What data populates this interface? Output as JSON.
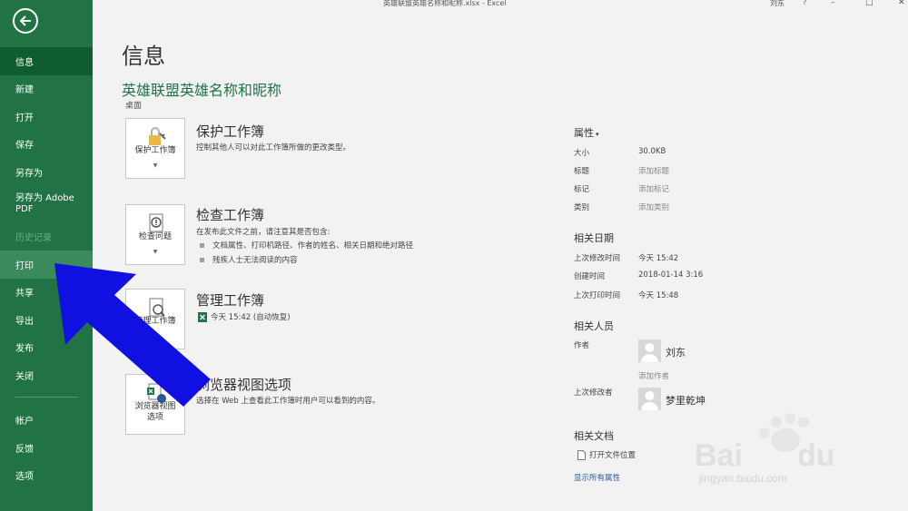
{
  "window": {
    "title": "英雄联盟英雄名称和昵称.xlsx  -  Excel",
    "user": "刘东",
    "help": "?",
    "minimize": "–",
    "restore": "□",
    "close": "✕"
  },
  "sidebar": {
    "items": [
      {
        "label": "信息",
        "state": "active"
      },
      {
        "label": "新建"
      },
      {
        "label": "打开"
      },
      {
        "label": "保存"
      },
      {
        "label": "另存为"
      },
      {
        "label": "另存为 Adobe PDF"
      },
      {
        "label": "历史记录",
        "state": "disabled"
      },
      {
        "label": "打印",
        "state": "hover"
      },
      {
        "label": "共享"
      },
      {
        "label": "导出"
      },
      {
        "label": "发布"
      },
      {
        "label": "关闭"
      }
    ],
    "bottom": [
      {
        "label": "帐户"
      },
      {
        "label": "反馈"
      },
      {
        "label": "选项"
      }
    ]
  },
  "info": {
    "page_title": "信息",
    "doc_title": "英雄联盟英雄名称和昵称",
    "doc_path": "桌面",
    "protect": {
      "button": "保护工作簿",
      "title": "保护工作簿",
      "desc": "控制其他人可以对此工作簿所做的更改类型。"
    },
    "inspect": {
      "button": "检查问题",
      "title": "检查工作簿",
      "desc": "在发布此文件之前，请注意其是否包含:",
      "bullets": [
        "文档属性、打印机路径、作者的姓名、相关日期和绝对路径",
        "残疾人士无法阅读的内容"
      ]
    },
    "manage": {
      "button": "管理工作簿",
      "title": "管理工作簿",
      "entry": "今天 15:42 (自动恢复)"
    },
    "browser": {
      "button": "浏览器视图选项",
      "title": "浏览器视图选项",
      "desc": "选择在 Web 上查看此工作簿时用户可以看到的内容。"
    }
  },
  "properties": {
    "heading": "属性",
    "rows": [
      {
        "label": "大小",
        "value": "30.0KB"
      },
      {
        "label": "标题",
        "value": "添加标题"
      },
      {
        "label": "标记",
        "value": "添加标记"
      },
      {
        "label": "类别",
        "value": "添加类别"
      }
    ],
    "dates_heading": "相关日期",
    "dates": [
      {
        "label": "上次修改时间",
        "value": "今天 15:42"
      },
      {
        "label": "创建时间",
        "value": "2018-01-14 3:16"
      },
      {
        "label": "上次打印时间",
        "value": "今天 15:48"
      }
    ],
    "people_heading": "相关人员",
    "author_label": "作者",
    "author_name": "刘东",
    "add_author": "添加作者",
    "modifier_label": "上次修改者",
    "modifier_name": "梦里乾坤",
    "docs_heading": "相关文档",
    "open_location": "打开文件位置",
    "show_all": "显示所有属性"
  },
  "watermark": {
    "text": "jingyan.baidu.com"
  },
  "colors": {
    "sidebar": "#217346",
    "active": "#0e5c2f",
    "accent_green": "#217346",
    "link": "#2b579a",
    "arrow": "#1010e0"
  }
}
